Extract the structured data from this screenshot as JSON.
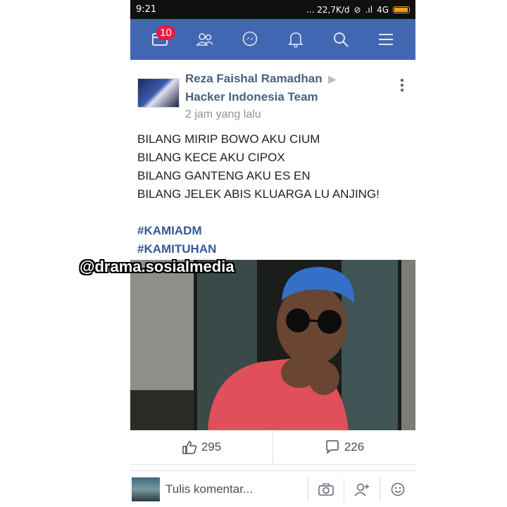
{
  "status_bar": {
    "time": "9:21",
    "network_speed": "... 22,7K/d",
    "network_type": "4G",
    "battery_level": 0.9
  },
  "navbar": {
    "notification_badge": "10",
    "icons": [
      "news-feed-icon",
      "friends-icon",
      "messenger-icon",
      "bell-icon",
      "search-icon",
      "menu-icon"
    ]
  },
  "post": {
    "author_name": "Reza Faishal Ramadhan",
    "group_name": "Hacker Indonesia Team",
    "timestamp": "2 jam yang lalu",
    "body": "BILANG MIRIP BOWO AKU CIUM\nBILANG KECE AKU CIPOX\nBILANG GANTENG AKU ES EN\nBILANG JELEK ABIS KLUARGA LU ANJING!",
    "hashtags": [
      "#KAMIADM",
      "#KAMITUHAN"
    ],
    "likes": "295",
    "comments": "226"
  },
  "comment_bar": {
    "placeholder": "Tulis komentar..."
  },
  "watermark": "@drama.sosialmedia",
  "colors": {
    "fb_blue": "#4267b2",
    "badge_red": "#e41e3f",
    "author_color": "#4b5f80",
    "hashtag_color": "#365899"
  }
}
